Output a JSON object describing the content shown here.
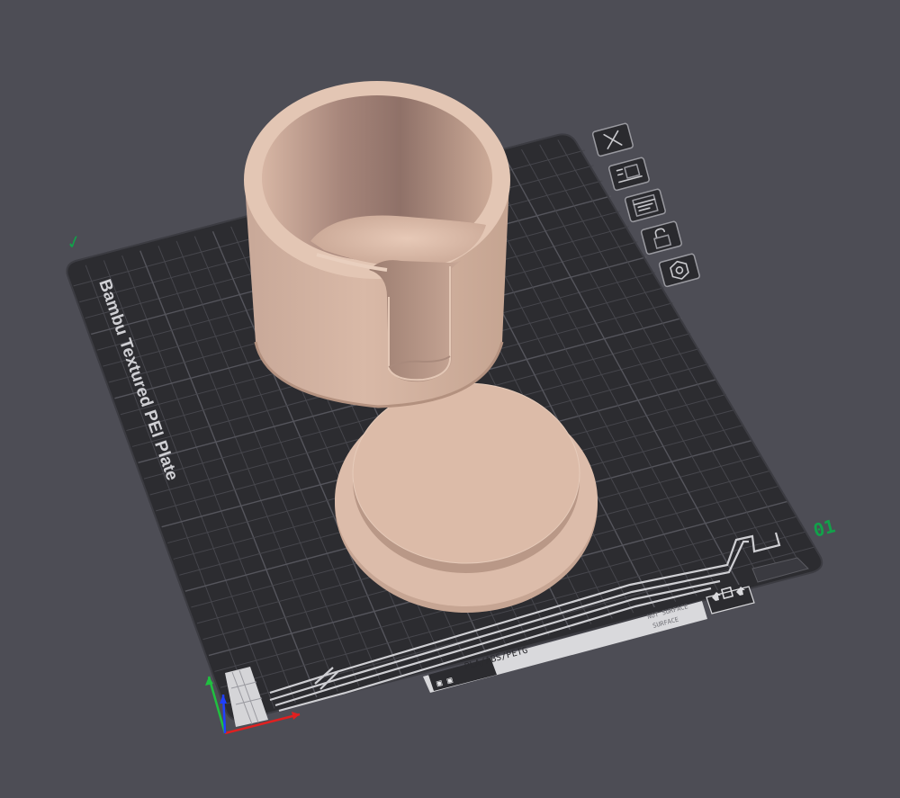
{
  "plate": {
    "name": "Bambu Textured PEI Plate",
    "number": "01",
    "filament_label": "PLA/ABS/PETG",
    "surface_hint": "NOT SURFACE",
    "surface_hint_2": "SURFACE",
    "check_mark": "✓"
  },
  "toolbar": {
    "buttons": [
      {
        "name": "close-plate-button",
        "icon": "close-icon"
      },
      {
        "name": "arrange-button",
        "icon": "arrange-icon"
      },
      {
        "name": "plate-settings-button",
        "icon": "settings-icon"
      },
      {
        "name": "lock-button",
        "icon": "lock-icon"
      },
      {
        "name": "orient-button",
        "icon": "hexagon-icon"
      }
    ]
  },
  "objects": [
    {
      "name": "cup-with-slot",
      "color": "#dcbba8"
    },
    {
      "name": "round-lid",
      "color": "#dcbba8"
    }
  ],
  "colors": {
    "background": "#4d4d55",
    "plate": "#2c2c30",
    "grid": "#46464c",
    "model": "#dcbba8",
    "plate_number": "#12a14a",
    "axis_x": "#e02020",
    "axis_y": "#20c040",
    "axis_z": "#2040ff"
  }
}
